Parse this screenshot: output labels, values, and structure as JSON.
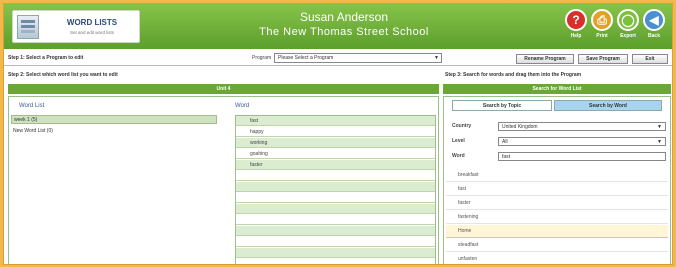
{
  "header": {
    "app_title": "WORD LISTS",
    "app_subtitle": "Set and edit word lists",
    "user_name": "Susan Anderson",
    "school_name": "The New Thomas Street School",
    "buttons": [
      {
        "id": "help",
        "label": "Help",
        "glyph": "?",
        "color": "#d9302c"
      },
      {
        "id": "print",
        "label": "Print",
        "glyph": "⎙",
        "color": "#e2a127"
      },
      {
        "id": "export",
        "label": "Export",
        "glyph": "◯",
        "color": "#7fbf3f"
      },
      {
        "id": "back",
        "label": "Back",
        "glyph": "◀",
        "color": "#4a8fd0"
      }
    ]
  },
  "toolbar": {
    "step1": "Step 1: Select a Program to edit",
    "program_label": "Program",
    "program_select": "Please Select a Program",
    "rename_label": "Rename Program",
    "save_label": "Save Program",
    "exit_label": "Exit"
  },
  "steps": {
    "step2": "Step 2: Select which word list you want to edit",
    "step3": "Step 3: Search for words and drag them into the Program"
  },
  "left": {
    "unit_title": "Unit 4",
    "wordlist_header": "Word List",
    "word_header": "Word",
    "wordlists": [
      "week 1 (5)",
      "New Word List (0)"
    ],
    "words": [
      "fast",
      "happy",
      "working",
      "goahing",
      "faster",
      "",
      "",
      "",
      "",
      "",
      "",
      "",
      "",
      ""
    ]
  },
  "right": {
    "title": "Search for Word List",
    "tab_topic": "Search by Topic",
    "tab_word": "Search by Word",
    "country_label": "Country",
    "country_value": "United Kingdom",
    "level_label": "Level",
    "level_value": "All",
    "word_label": "Word",
    "word_value": "fast",
    "results": [
      "breakfast",
      "fast",
      "faster",
      "fastening",
      "Home",
      "steadfast",
      "unfasten"
    ]
  }
}
